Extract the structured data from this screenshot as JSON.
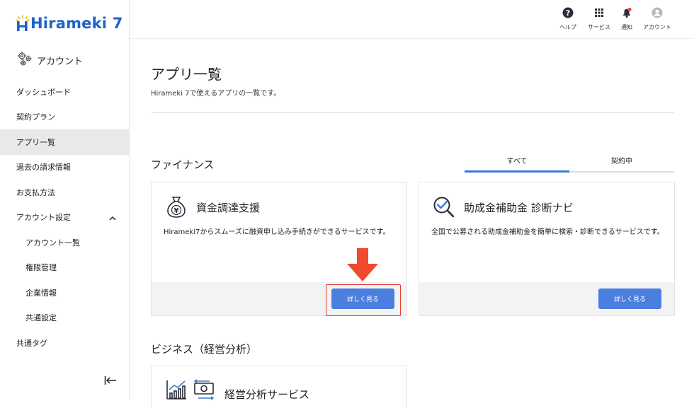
{
  "brand": {
    "name": "Hirameki 7"
  },
  "sidebar": {
    "header_label": "アカウント",
    "items": [
      {
        "label": "ダッシュボード"
      },
      {
        "label": "契約プラン"
      },
      {
        "label": "アプリ一覧",
        "active": true
      },
      {
        "label": "過去の請求情報"
      },
      {
        "label": "お支払方法"
      },
      {
        "label": "アカウント設定",
        "expanded": true
      },
      {
        "label": "アカウント一覧"
      },
      {
        "label": "権限管理"
      },
      {
        "label": "企業情報"
      },
      {
        "label": "共通設定"
      },
      {
        "label": "共通タグ"
      }
    ]
  },
  "topbar": {
    "help": "ヘルプ",
    "services": "サービス",
    "notifications": "通知",
    "account": "アカウント"
  },
  "page": {
    "title": "アプリ一覧",
    "description": "Hirameki 7で使えるアプリの一覧です。"
  },
  "tabs": {
    "all": "すべて",
    "contracted": "契約中"
  },
  "sections": {
    "finance": {
      "title": "ファイナンス",
      "cards": [
        {
          "title": "資金調達支援",
          "description": "Hirameki7からスムーズに融資申し込み手続きができるサービスです。",
          "button": "詳しく見る"
        },
        {
          "title": "助成金補助金 診断ナビ",
          "description": "全国で公募される助成金補助金を簡単に検索・診断できるサービスです。",
          "button": "詳しく見る"
        }
      ]
    },
    "business": {
      "title": "ビジネス（経営分析）",
      "cards": [
        {
          "title": "経営分析サービス"
        }
      ]
    }
  },
  "colors": {
    "accent": "#4a7fe0",
    "brand": "#1f63c6",
    "highlight": "#e23a2e"
  }
}
